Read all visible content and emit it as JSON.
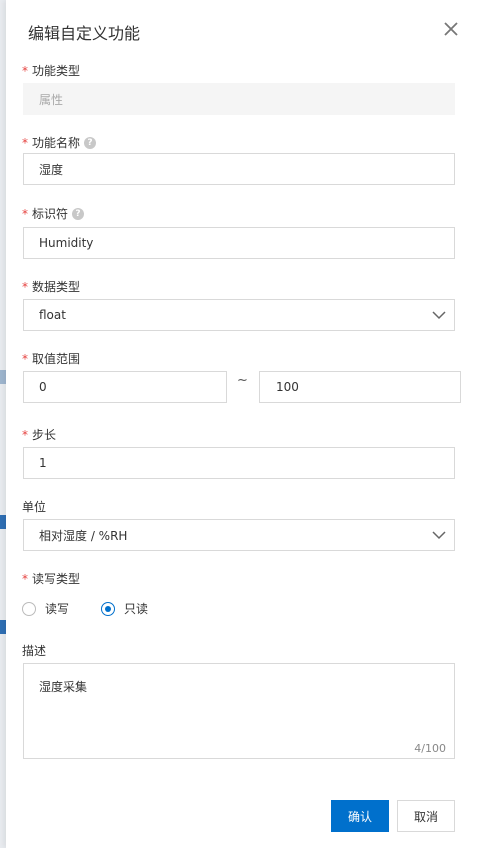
{
  "dialog": {
    "title": "编辑自定义功能"
  },
  "form": {
    "function_type": {
      "label": "功能类型",
      "value": "属性"
    },
    "function_name": {
      "label": "功能名称",
      "value": "湿度"
    },
    "identifier": {
      "label": "标识符",
      "value": "Humidity"
    },
    "data_type": {
      "label": "数据类型",
      "value": "float"
    },
    "value_range": {
      "label": "取值范围",
      "min": "0",
      "separator": "~",
      "max": "100"
    },
    "step": {
      "label": "步长",
      "value": "1"
    },
    "unit": {
      "label": "单位",
      "value": "相对湿度 / %RH"
    },
    "rw_type": {
      "label": "读写类型",
      "options": [
        "读写",
        "只读"
      ],
      "selected": "只读"
    },
    "description": {
      "label": "描述",
      "value": "湿度采集",
      "counter": "4/100"
    }
  },
  "footer": {
    "confirm_label": "确认",
    "cancel_label": "取消"
  },
  "icons": {
    "close": "close-icon",
    "help": "help-icon",
    "chevron": "chevron-down-icon"
  },
  "colors": {
    "primary": "#0070cc",
    "required": "#e64340",
    "disabled_bg": "#f5f5f5"
  }
}
